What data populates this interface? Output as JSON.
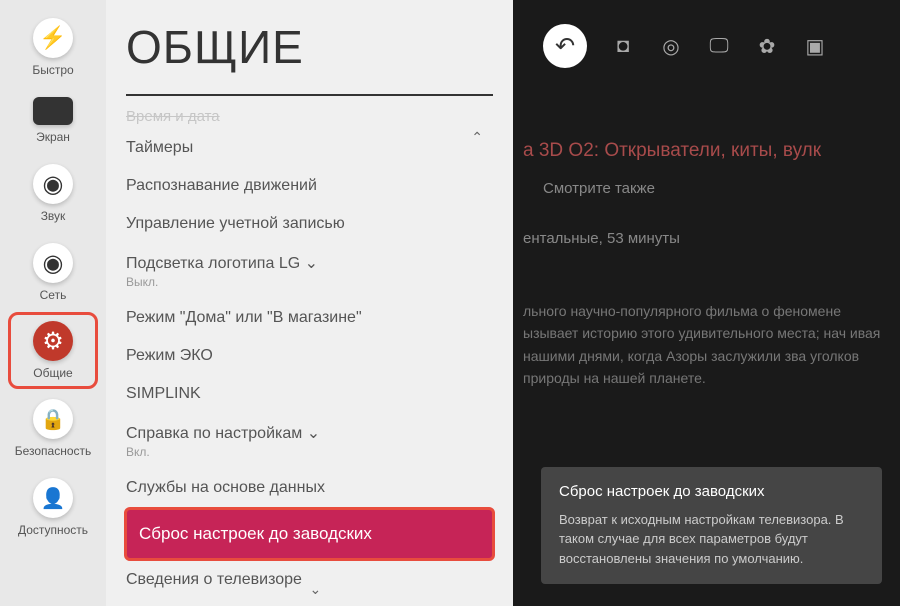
{
  "sidebar": {
    "items": [
      {
        "label": "Быстро"
      },
      {
        "label": "Экран"
      },
      {
        "label": "Звук"
      },
      {
        "label": "Сеть"
      },
      {
        "label": "Общие"
      },
      {
        "label": "Безопасность"
      },
      {
        "label": "Доступность"
      }
    ]
  },
  "page": {
    "title": "ОБЩИЕ"
  },
  "menu": {
    "cut_item": "Время и дата",
    "items": [
      {
        "label": "Таймеры",
        "sub": ""
      },
      {
        "label": "Распознавание движений",
        "sub": ""
      },
      {
        "label": "Управление учетной записью",
        "sub": ""
      },
      {
        "label": "Подсветка логотипа LG ⌄",
        "sub": "Выкл."
      },
      {
        "label": "Режим \"Дома\" или \"В магазине\"",
        "sub": ""
      },
      {
        "label": "Режим ЭКО",
        "sub": ""
      },
      {
        "label": "SIMPLINK",
        "sub": ""
      },
      {
        "label": "Справка по настройкам ⌄",
        "sub": "Вкл."
      },
      {
        "label": "Службы на основе данных",
        "sub": ""
      },
      {
        "label": "Сброс настроек до заводских",
        "sub": "",
        "selected": true
      },
      {
        "label": "Сведения о телевизоре",
        "sub": ""
      }
    ]
  },
  "background": {
    "title": "а 3D O2: Открыватели, киты, вулк",
    "see_also": "Смотрите также",
    "duration": "ентальные, 53 минуты",
    "desc": "льного научно-популярного фильма о феномене ызывает историю этого удивительного места; нач ивая нашими днями, когда Азоры заслужили зва уголков природы на нашей планете."
  },
  "tooltip": {
    "title": "Сброс настроек до заводских",
    "text": "Возврат к исходным настройкам телевизора. В таком случае для всех параметров будут восстановлены значения по умолчанию."
  },
  "icons": {
    "up": "⌃",
    "down": "⌄",
    "back": "↶"
  }
}
